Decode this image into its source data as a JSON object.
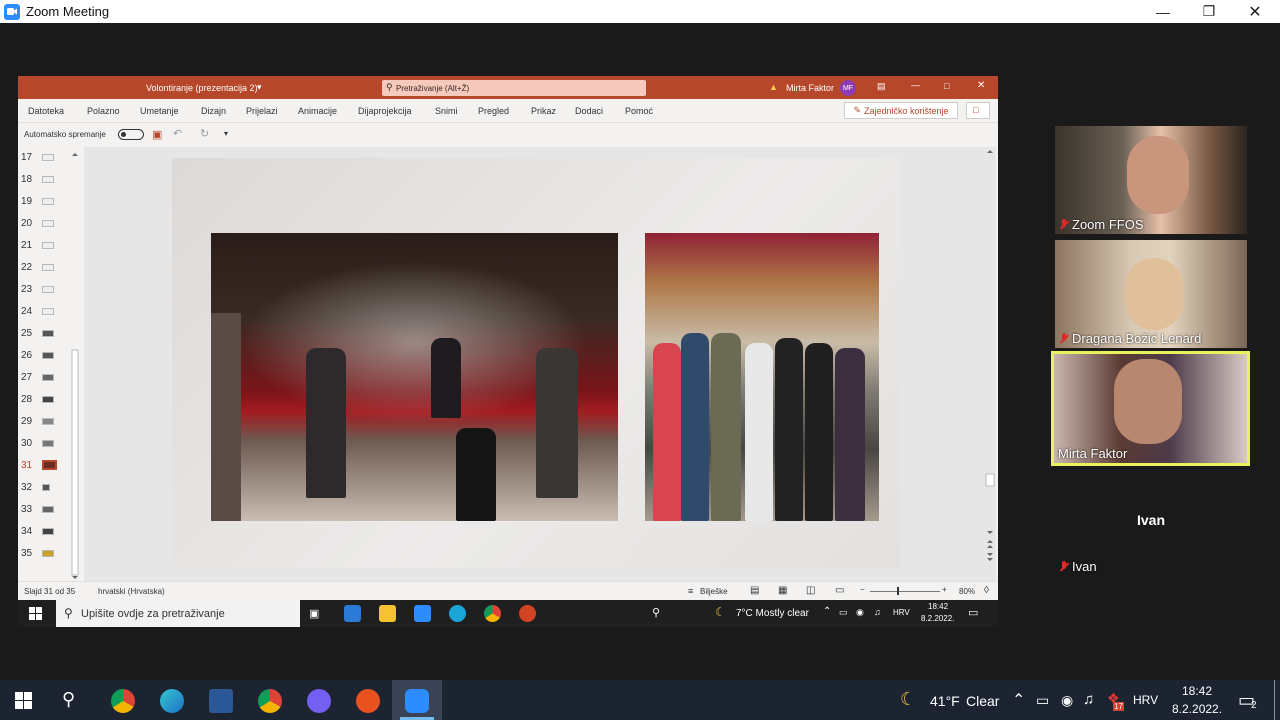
{
  "zoom": {
    "window_title": "Zoom Meeting",
    "participants": [
      {
        "name": "Zoom FFOS",
        "muted": true,
        "active": false
      },
      {
        "name": "Dragana Božić Lenard",
        "muted": true,
        "active": false
      },
      {
        "name": "Mirta Faktor",
        "muted": false,
        "active": true
      },
      {
        "name": "Ivan",
        "muted": true,
        "active": false
      }
    ],
    "ivan_center_label": "Ivan"
  },
  "ppt": {
    "doc_title": "Volontiranje (prezentacija 2)",
    "search_placeholder": "Pretraživanje (Alt+Ž)",
    "user_name": "Mirta Faktor",
    "user_initials": "MF",
    "menu": [
      "Datoteka",
      "Polazno",
      "Umetanje",
      "Dizajn",
      "Prijelazi",
      "Animacije",
      "Dijaprojekcija",
      "Snimi",
      "Pregled",
      "Prikaz",
      "Dodaci",
      "Pomoć"
    ],
    "share_label": "Zajedničko korištenje",
    "autosave_label": "Automatsko spremanje",
    "slide_numbers": [
      "17",
      "18",
      "19",
      "20",
      "21",
      "22",
      "23",
      "24",
      "25",
      "26",
      "27",
      "28",
      "29",
      "30",
      "31",
      "32",
      "33",
      "34",
      "35"
    ],
    "current_slide": "31",
    "status_slide": "Slajd 31 od 35",
    "status_lang": "hrvatski (Hrvatska)",
    "notes_label": "Bilješke",
    "zoom_level": "80%",
    "taskbar_search": "Upišite ovdje za pretraživanje",
    "weather": "7°C  Mostly clear",
    "lang": "HRV",
    "time": "18:42",
    "date": "8.2.2022."
  },
  "taskbar": {
    "weather_temp": "41°F",
    "weather_desc": "Clear",
    "lang": "HRV",
    "time": "18:42",
    "date": "8.2.2022.",
    "notifications": "2",
    "badge": "17"
  },
  "colors": {
    "ppt_accent": "#b7472a",
    "zoom_active_border": "#e8f25a",
    "taskbar": "#1c2331"
  }
}
